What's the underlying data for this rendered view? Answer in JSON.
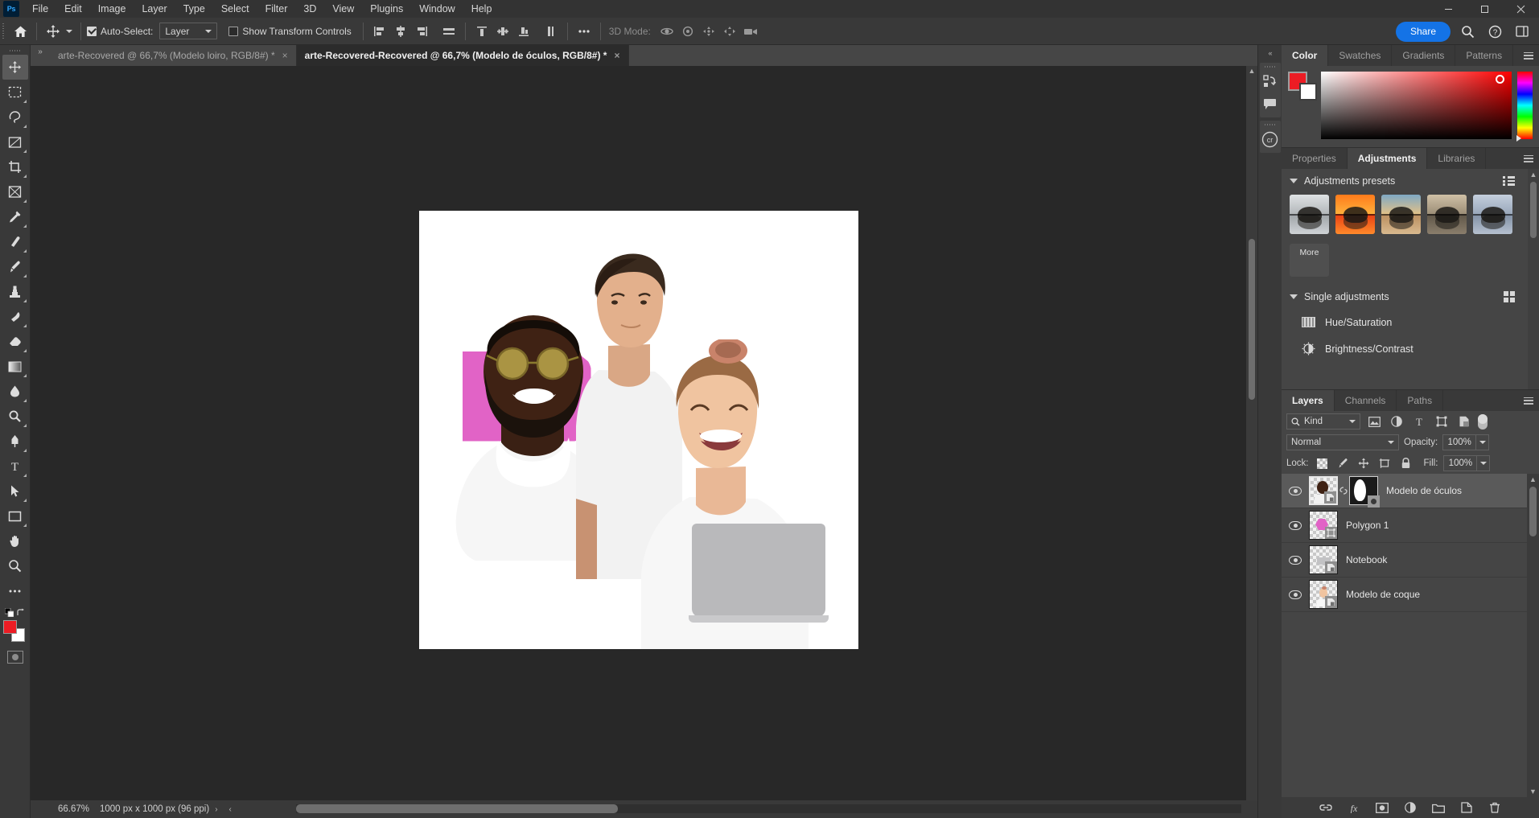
{
  "app": {
    "logo": "ps-logo",
    "menus": [
      "File",
      "Edit",
      "Image",
      "Layer",
      "Type",
      "Select",
      "Filter",
      "3D",
      "View",
      "Plugins",
      "Window",
      "Help"
    ],
    "window_controls": [
      "minimize",
      "maximize",
      "close"
    ]
  },
  "options_bar": {
    "home_icon": "home-icon",
    "tool_icon": "move-tool-icon",
    "auto_select_label": "Auto-Select:",
    "auto_select_checked": true,
    "auto_select_target": "Layer",
    "show_transform_label": "Show Transform Controls",
    "show_transform_checked": false,
    "align_icons": [
      "align-left-edges-icon",
      "align-horizontal-centers-icon",
      "align-right-edges-icon",
      "distribute-horizontal-icon"
    ],
    "align_icons_2": [
      "align-top-edges-icon",
      "align-vertical-centers-icon",
      "align-bottom-edges-icon",
      "distribute-vertical-icon"
    ],
    "more_icon": "more-options-icon",
    "mode3d_label": "3D Mode:",
    "mode3d_icons": [
      "orbit-3d-icon",
      "roll-3d-icon",
      "pan-3d-icon",
      "slide-3d-icon",
      "zoom-3d-camera-icon"
    ],
    "share_label": "Share",
    "right_icons": [
      "search-icon",
      "help-icon",
      "workspace-icon"
    ]
  },
  "toolbar": {
    "tools": [
      "move-tool",
      "rectangular-marquee-tool",
      "lasso-tool",
      "object-selection-tool",
      "crop-tool",
      "frame-tool",
      "eyedropper-tool",
      "spot-healing-brush-tool",
      "brush-tool",
      "clone-stamp-tool",
      "history-brush-tool",
      "eraser-tool",
      "gradient-tool",
      "blur-tool",
      "dodge-tool",
      "pen-tool",
      "horizontal-type-tool",
      "path-selection-tool",
      "rectangle-tool",
      "hand-tool",
      "zoom-tool",
      "edit-toolbar-tool"
    ],
    "foreground_color": "#ec1c24",
    "background_color": "#ffffff",
    "quick-mask": "quick-mask-toggle"
  },
  "tabs": [
    {
      "title": "arte-Recovered @ 66,7% (Modelo loiro, RGB/8#) *",
      "active": false,
      "close": "×"
    },
    {
      "title": "arte-Recovered-Recovered @ 66,7% (Modelo de óculos, RGB/8#) *",
      "active": true,
      "close": "×"
    }
  ],
  "status_bar": {
    "zoom": "66.67%",
    "doc_size": "1000 px x 1000 px (96 ppi)",
    "arrows": [
      "›",
      "‹"
    ]
  },
  "mini_dock": {
    "collapse": "«",
    "icons": [
      "history-icon",
      "comments-icon",
      "creative-cloud-icon"
    ]
  },
  "color_panel": {
    "tabs": [
      {
        "label": "Color",
        "active": true
      },
      {
        "label": "Swatches",
        "active": false
      },
      {
        "label": "Gradients",
        "active": false
      },
      {
        "label": "Patterns",
        "active": false
      }
    ],
    "menu_icon": "panel-menu-icon",
    "foreground": "#ec1c24",
    "background": "#ffffff"
  },
  "adjustments_panel": {
    "tabs": [
      {
        "label": "Properties",
        "active": false
      },
      {
        "label": "Adjustments",
        "active": true
      },
      {
        "label": "Libraries",
        "active": false
      }
    ],
    "menu_icon": "panel-menu-icon",
    "presets_section": {
      "title": "Adjustments presets",
      "view_icon": "list-view-icon",
      "thumbnails": [
        {
          "name": "preset-black-white",
          "sky": "#c9ccce",
          "water": "#9da2a6"
        },
        {
          "name": "preset-warm-sunset",
          "sky": "#f0631b",
          "water": "#e8511a"
        },
        {
          "name": "preset-cool-dusk",
          "sky": "#9ab6cc",
          "water": "#c99a6e"
        },
        {
          "name": "preset-sepia",
          "sky": "#c6b79e",
          "water": "#6d6253"
        },
        {
          "name": "preset-cold-blue",
          "sky": "#b6c3d4",
          "water": "#8b9aad"
        }
      ],
      "more_label": "More"
    },
    "single_section": {
      "title": "Single adjustments",
      "view_icon": "grid-view-icon",
      "items": [
        {
          "label": "Hue/Saturation",
          "icon": "hue-saturation-icon"
        },
        {
          "label": "Brightness/Contrast",
          "icon": "brightness-contrast-icon"
        }
      ]
    }
  },
  "layers_panel": {
    "tabs": [
      {
        "label": "Layers",
        "active": true
      },
      {
        "label": "Channels",
        "active": false
      },
      {
        "label": "Paths",
        "active": false
      }
    ],
    "menu_icon": "panel-menu-icon",
    "filter": {
      "kind_label": "Kind",
      "search_icon": "search-icon",
      "type_icons": [
        "filter-pixel-icon",
        "filter-adjustment-icon",
        "filter-type-icon",
        "filter-shape-icon",
        "filter-smart-object-icon"
      ],
      "toggle": "filter-toggle"
    },
    "blend_mode": "Normal",
    "opacity_label": "Opacity:",
    "opacity_value": "100%",
    "lock_label": "Lock:",
    "lock_icons": [
      "lock-transparent-pixels-icon",
      "lock-image-pixels-icon",
      "lock-position-icon",
      "lock-artboard-nesting-icon",
      "lock-all-icon"
    ],
    "fill_label": "Fill:",
    "fill_value": "100%",
    "layers": [
      {
        "name": "Modelo de óculos",
        "visible": true,
        "selected": true,
        "has_mask": true,
        "smart_object": true
      },
      {
        "name": "Polygon 1",
        "visible": true,
        "selected": false,
        "has_mask": false,
        "shape": true
      },
      {
        "name": "Notebook",
        "visible": true,
        "selected": false,
        "has_mask": false,
        "smart_object": true
      },
      {
        "name": "Modelo de coque",
        "visible": true,
        "selected": false,
        "has_mask": false,
        "smart_object": true
      }
    ],
    "footer_icons": [
      "link-layers-icon",
      "layer-style-icon",
      "add-layer-mask-icon",
      "new-adjustment-layer-icon",
      "new-group-icon",
      "new-layer-icon",
      "delete-layer-icon"
    ]
  },
  "canvas": {
    "document_background": "#ffffff",
    "pink_shape_color": "#e163c6",
    "laptop_color": "#b9b9bb"
  }
}
